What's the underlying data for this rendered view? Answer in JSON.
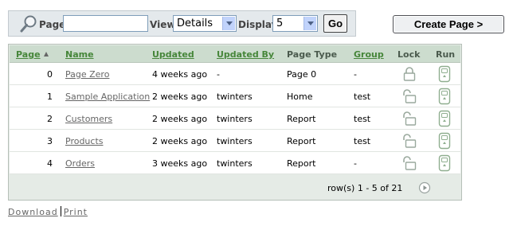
{
  "search": {
    "page_label": "Page",
    "page_value": "",
    "view_label": "View",
    "view_selected": "Details",
    "display_label": "Display",
    "display_selected": "5",
    "go_label": "Go"
  },
  "create_button_label": "Create Page >",
  "table": {
    "columns": [
      "Page",
      "Name",
      "Updated",
      "Updated By",
      "Page Type",
      "Group",
      "Lock",
      "Run"
    ],
    "rows": [
      {
        "page": "0",
        "name": "Page Zero",
        "updated": "4 weeks ago",
        "updated_by": "-",
        "page_type": "Page 0",
        "group": "-"
      },
      {
        "page": "1",
        "name": "Sample Application",
        "updated": "2 weeks ago",
        "updated_by": "twinters",
        "page_type": "Home",
        "group": "test"
      },
      {
        "page": "2",
        "name": "Customers",
        "updated": "2 weeks ago",
        "updated_by": "twinters",
        "page_type": "Report",
        "group": "test"
      },
      {
        "page": "3",
        "name": "Products",
        "updated": "2 weeks ago",
        "updated_by": "twinters",
        "page_type": "Report",
        "group": "test"
      },
      {
        "page": "4",
        "name": "Orders",
        "updated": "3 weeks ago",
        "updated_by": "twinters",
        "page_type": "Report",
        "group": "-"
      }
    ],
    "pagination": "row(s) 1 - 5 of 21"
  },
  "footer_links": {
    "download": "Download",
    "print": "Print"
  },
  "colors": {
    "header_link": "#46863a",
    "row_link": "#666666",
    "report_bg": "#e5ebe6",
    "header_bg": "#ccdcce"
  }
}
